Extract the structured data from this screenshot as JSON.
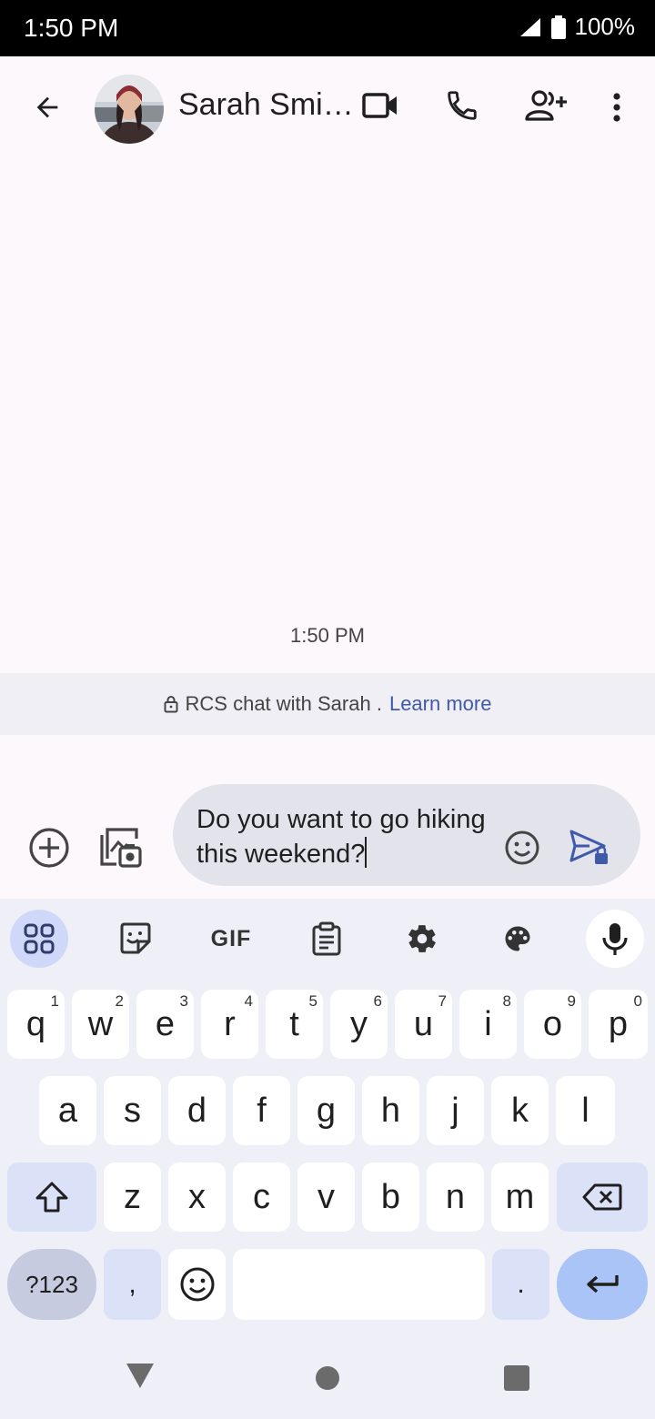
{
  "status_bar": {
    "time": "1:50 PM",
    "battery": "100%"
  },
  "header": {
    "contact_name": "Sarah Smi…"
  },
  "conversation": {
    "timestamp": "1:50 PM",
    "rcs_banner": "RCS chat with Sarah .",
    "rcs_link": "Learn more"
  },
  "compose": {
    "text": "Do you want to go hiking this weekend?"
  },
  "keyboard": {
    "toolbar": {
      "gif_label": "GIF"
    },
    "row1": [
      {
        "key": "q",
        "hint": "1"
      },
      {
        "key": "w",
        "hint": "2"
      },
      {
        "key": "e",
        "hint": "3"
      },
      {
        "key": "r",
        "hint": "4"
      },
      {
        "key": "t",
        "hint": "5"
      },
      {
        "key": "y",
        "hint": "6"
      },
      {
        "key": "u",
        "hint": "7"
      },
      {
        "key": "i",
        "hint": "8"
      },
      {
        "key": "o",
        "hint": "9"
      },
      {
        "key": "p",
        "hint": "0"
      }
    ],
    "row2": [
      "a",
      "s",
      "d",
      "f",
      "g",
      "h",
      "j",
      "k",
      "l"
    ],
    "row3": [
      "z",
      "x",
      "c",
      "v",
      "b",
      "n",
      "m"
    ],
    "symbols_label": "?123",
    "comma_label": ",",
    "period_label": "."
  },
  "colors": {
    "accent": "#3f5aa8",
    "compose_bg": "#e3e3ec",
    "keyboard_bg": "#eff0f7"
  }
}
